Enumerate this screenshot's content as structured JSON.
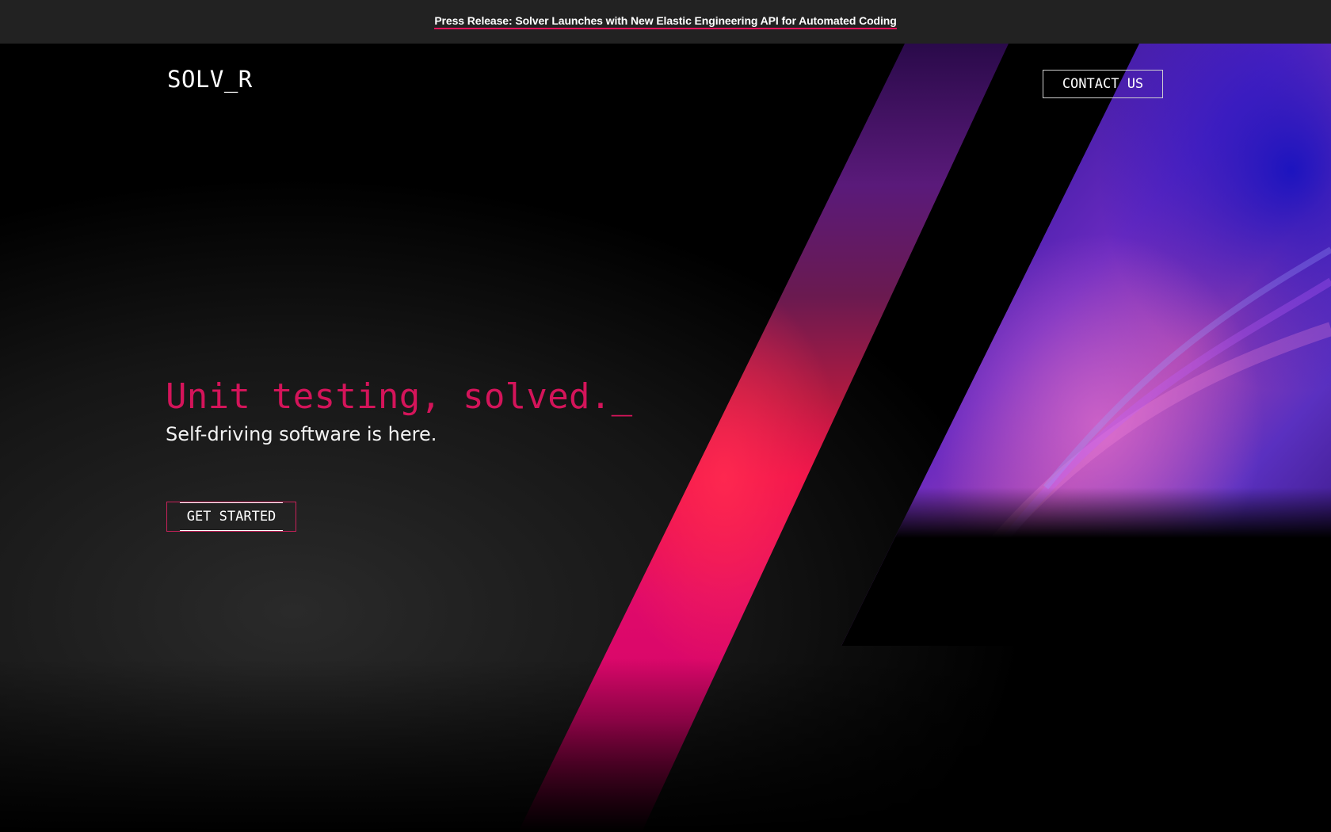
{
  "announcement": {
    "text": "Press Release: Solver Launches with New Elastic Engineering API for Automated Coding"
  },
  "header": {
    "logo": "SOLV_R",
    "contact_label": "CONTACT US"
  },
  "hero": {
    "headline": "Unit testing, solved._",
    "subheadline": "Self-driving software is here.",
    "cta_label": "GET STARTED"
  },
  "colors": {
    "accent": "#d4145a",
    "announce_bg": "#222222",
    "background": "#000000"
  }
}
